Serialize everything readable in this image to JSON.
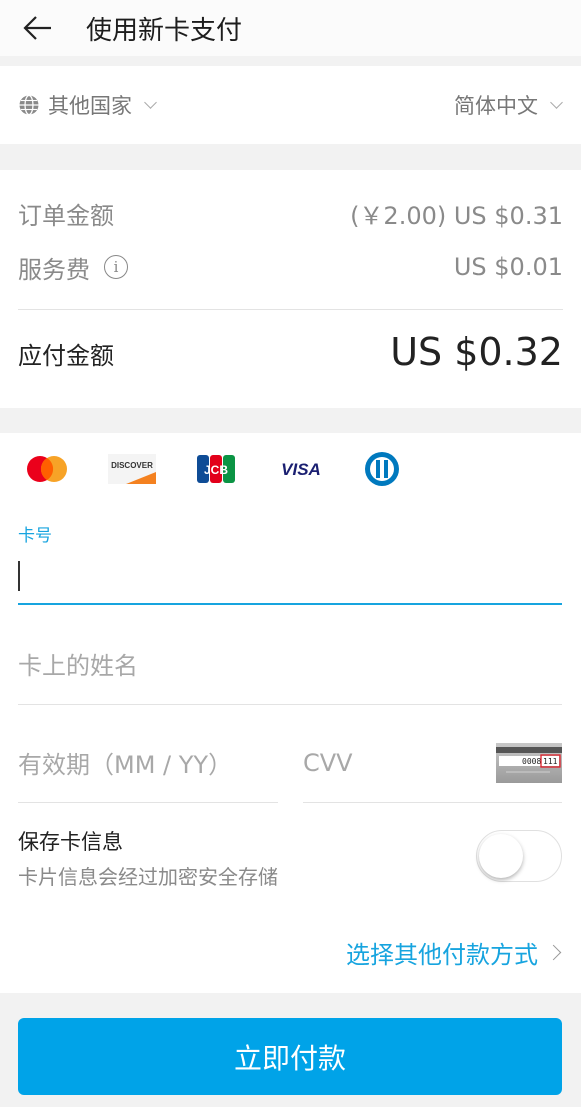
{
  "header": {
    "title": "使用新卡支付"
  },
  "locale": {
    "country": "其他国家",
    "language": "简体中文"
  },
  "amounts": {
    "order_label": "订单金额",
    "order_value": "(￥2.00) US $0.31",
    "fee_label": "服务费",
    "fee_value": "US $0.01",
    "total_label": "应付金额",
    "total_value": "US $0.32"
  },
  "brands": [
    "mastercard",
    "discover",
    "jcb",
    "visa",
    "diners-club"
  ],
  "brand_text": {
    "discover": "DISCOVER",
    "jcb": "JCB",
    "visa": "VISA"
  },
  "form": {
    "card_number_label": "卡号",
    "card_number_value": "",
    "name_placeholder": "卡上的姓名",
    "expiry_placeholder": "有效期（MM / YY）",
    "cvv_placeholder": "CVV",
    "cvv_sample_digits": "0008",
    "cvv_sample_code": "111"
  },
  "save_card": {
    "title": "保存卡信息",
    "subtitle": "卡片信息会经过加密安全存储",
    "enabled": false
  },
  "other_methods": {
    "label": "选择其他付款方式"
  },
  "pay_button": {
    "label": "立即付款"
  },
  "colors": {
    "accent": "#17a4df",
    "pay_button": "#00a3e8"
  },
  "icons": {
    "back": "arrow-left-icon",
    "globe": "globe-icon",
    "info": "info-icon",
    "chevron": "chevron-down-icon"
  }
}
